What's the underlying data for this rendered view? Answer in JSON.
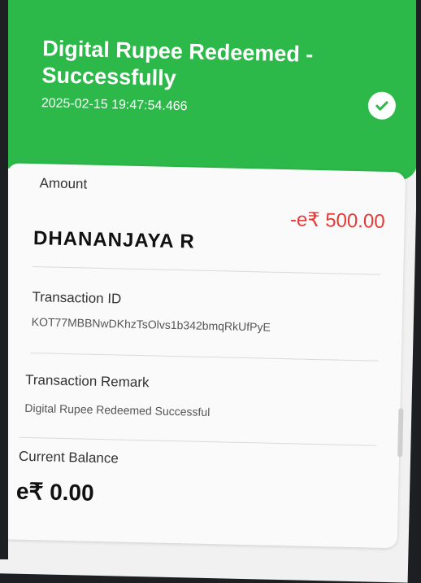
{
  "header": {
    "title": "Digital Rupee Redeemed - Successfully",
    "timestamp": "2025-02-15 19:47:54.466",
    "status_icon": "check-badge-icon",
    "background_color": "#2db84a"
  },
  "details": {
    "amount_label": "Amount",
    "amount_value": "-e₹ 500.00",
    "amount_color": "#e53935",
    "recipient_name": "DHANANJAYA  R",
    "transaction_id_label": "Transaction ID",
    "transaction_id_value": "KOT77MBBNwDKhzTsOlvs1b342bmqRkUfPyE",
    "remark_label": "Transaction Remark",
    "remark_value": "Digital Rupee Redeemed Successful",
    "balance_label": "Current Balance",
    "balance_value": "e₹ 0.00"
  }
}
